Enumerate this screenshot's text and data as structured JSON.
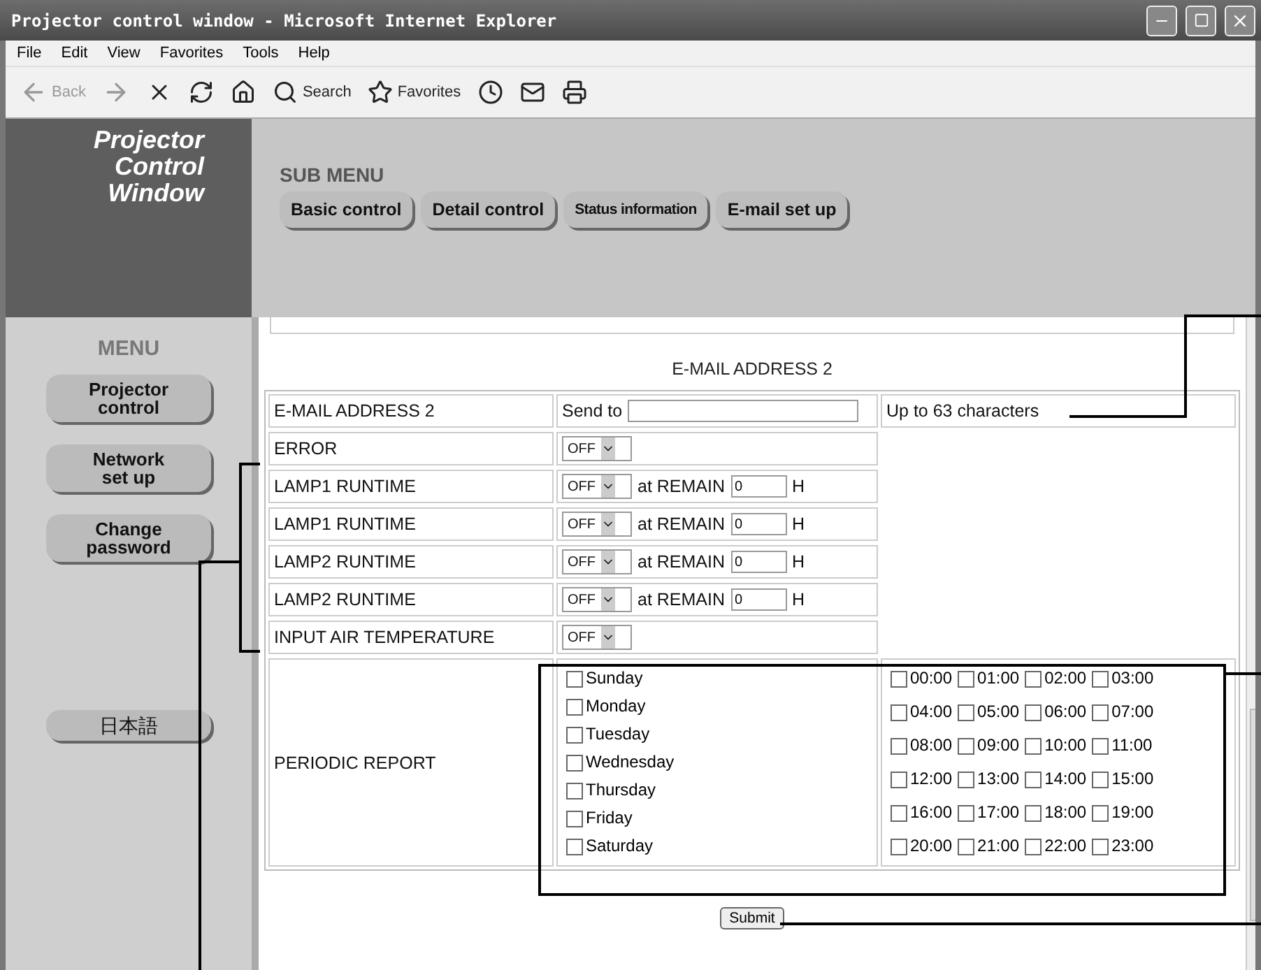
{
  "window": {
    "title": "Projector control window - Microsoft Internet Explorer"
  },
  "menu_bar": [
    "File",
    "Edit",
    "View",
    "Favorites",
    "Tools",
    "Help"
  ],
  "toolbar": [
    {
      "kind": "back",
      "label": "Back"
    },
    {
      "kind": "forward"
    },
    {
      "kind": "stop"
    },
    {
      "kind": "refresh"
    },
    {
      "kind": "home"
    },
    {
      "kind": "search",
      "label": "Search"
    },
    {
      "kind": "favorites",
      "label": "Favorites"
    },
    {
      "kind": "history"
    },
    {
      "kind": "mail"
    },
    {
      "kind": "print"
    }
  ],
  "logo": {
    "lines": [
      "Projector",
      "Control",
      "Window"
    ]
  },
  "sub_menu": {
    "title": "SUB MENU",
    "buttons": [
      {
        "label": "Basic control",
        "compact": false
      },
      {
        "label": "Detail control",
        "compact": false
      },
      {
        "label": "Status information",
        "compact": true
      },
      {
        "label": "E-mail set up",
        "compact": false
      }
    ]
  },
  "sidebar": {
    "title": "MENU",
    "items": [
      {
        "lines": [
          "Projector",
          "control"
        ]
      },
      {
        "lines": [
          "Network",
          "set up"
        ]
      },
      {
        "lines": [
          "Change",
          "password"
        ]
      },
      {
        "lines": [
          "日本語"
        ]
      }
    ]
  },
  "section_heading": "E-MAIL ADDRESS 2",
  "email_row": {
    "label": "E-MAIL ADDRESS 2",
    "prefix": "Send to",
    "note": "Up to 63 characters"
  },
  "alerts": [
    {
      "label": "ERROR",
      "value": "OFF"
    },
    {
      "label": "LAMP1 RUNTIME",
      "value": "OFF",
      "remain": {
        "prefix": "at REMAIN",
        "value": "0",
        "unit": "H"
      }
    },
    {
      "label": "LAMP1 RUNTIME",
      "value": "OFF",
      "remain": {
        "prefix": "at REMAIN",
        "value": "0",
        "unit": "H"
      }
    },
    {
      "label": "LAMP2 RUNTIME",
      "value": "OFF",
      "remain": {
        "prefix": "at REMAIN",
        "value": "0",
        "unit": "H"
      }
    },
    {
      "label": "LAMP2 RUNTIME",
      "value": "OFF",
      "remain": {
        "prefix": "at REMAIN",
        "value": "0",
        "unit": "H"
      }
    },
    {
      "label": "INPUT AIR TEMPERATURE",
      "value": "OFF"
    }
  ],
  "periodic_report": {
    "label": "PERIODIC REPORT",
    "days": [
      {
        "label": "Sunday",
        "checked": false
      },
      {
        "label": "Monday",
        "checked": false
      },
      {
        "label": "Tuesday",
        "checked": false
      },
      {
        "label": "Wednesday",
        "checked": false
      },
      {
        "label": "Thursday",
        "checked": false
      },
      {
        "label": "Friday",
        "checked": false
      },
      {
        "label": "Saturday",
        "checked": false
      }
    ],
    "hours": [
      {
        "label": "00:00",
        "checked": false
      },
      {
        "label": "01:00",
        "checked": false
      },
      {
        "label": "02:00",
        "checked": false
      },
      {
        "label": "03:00",
        "checked": false
      },
      {
        "label": "04:00",
        "checked": false
      },
      {
        "label": "05:00",
        "checked": false
      },
      {
        "label": "06:00",
        "checked": false
      },
      {
        "label": "07:00",
        "checked": false
      },
      {
        "label": "08:00",
        "checked": false
      },
      {
        "label": "09:00",
        "checked": false
      },
      {
        "label": "10:00",
        "checked": false
      },
      {
        "label": "11:00",
        "checked": false
      },
      {
        "label": "12:00",
        "checked": false
      },
      {
        "label": "13:00",
        "checked": false
      },
      {
        "label": "14:00",
        "checked": false
      },
      {
        "label": "15:00",
        "checked": false
      },
      {
        "label": "16:00",
        "checked": false
      },
      {
        "label": "17:00",
        "checked": false
      },
      {
        "label": "18:00",
        "checked": false
      },
      {
        "label": "19:00",
        "checked": false
      },
      {
        "label": "20:00",
        "checked": false
      },
      {
        "label": "21:00",
        "checked": false
      },
      {
        "label": "22:00",
        "checked": false
      },
      {
        "label": "23:00",
        "checked": false
      }
    ]
  },
  "submit": "Submit"
}
